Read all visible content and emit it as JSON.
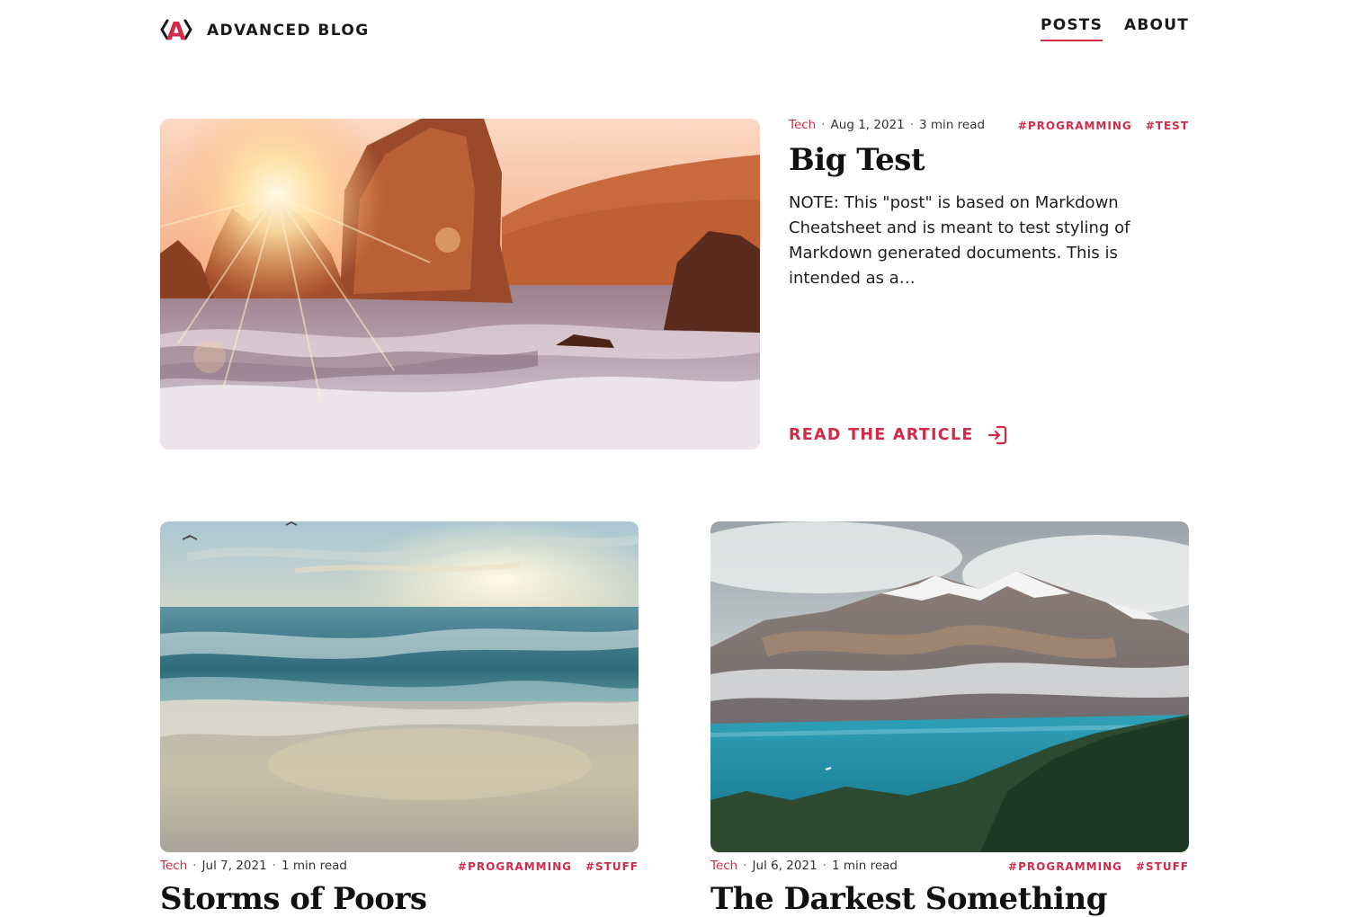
{
  "site": {
    "logo_letter": "A",
    "brand_name": "ADVANCED BLOG",
    "accent_color": "#d22b48"
  },
  "nav": {
    "items": [
      {
        "label": "POSTS",
        "active": true
      },
      {
        "label": "ABOUT",
        "active": false
      }
    ]
  },
  "featured": {
    "category": "Tech",
    "date": "Aug 1, 2021",
    "read_time": "3 min read",
    "tags": [
      "#PROGRAMMING",
      "#TEST"
    ],
    "title": "Big Test",
    "excerpt": "NOTE: This \"post\" is based on Markdown Cheatsheet and is meant to test styling of Markdown generated documents. This is intended as a…",
    "read_more_label": "READ THE ARTICLE",
    "read_more_icon": "sign-in-icon"
  },
  "posts": [
    {
      "category": "Tech",
      "date": "Jul 7, 2021",
      "read_time": "1 min read",
      "tags": [
        "#PROGRAMMING",
        "#STUFF"
      ],
      "title": "Storms of Poors"
    },
    {
      "category": "Tech",
      "date": "Jul 6, 2021",
      "read_time": "1 min read",
      "tags": [
        "#PROGRAMMING",
        "#STUFF"
      ],
      "title": "The Darkest Something"
    }
  ]
}
